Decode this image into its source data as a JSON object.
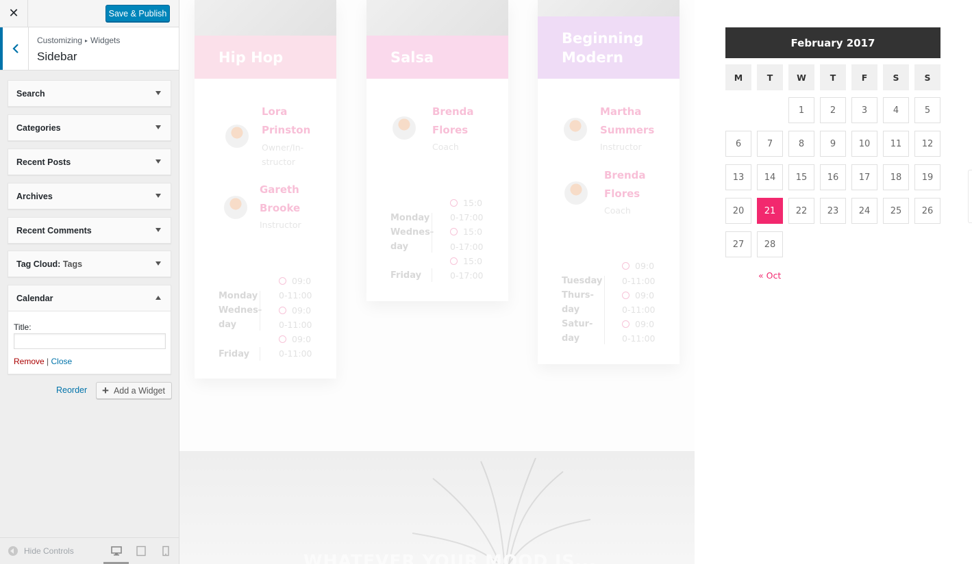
{
  "customizer": {
    "close_symbol": "✕",
    "save_label": "Save & Publish",
    "breadcrumb": {
      "root": "Customizing",
      "separator": "▸",
      "current": "Widgets"
    },
    "section_title": "Sidebar",
    "widgets": [
      {
        "title": "Search",
        "subtitle": ""
      },
      {
        "title": "Categories",
        "subtitle": ""
      },
      {
        "title": "Recent Posts",
        "subtitle": ""
      },
      {
        "title": "Archives",
        "subtitle": ""
      },
      {
        "title": "Recent Comments",
        "subtitle": ""
      },
      {
        "title": "Tag Cloud:",
        "subtitle": "Tags"
      },
      {
        "title": "Calendar",
        "subtitle": ""
      }
    ],
    "calendar_form": {
      "title_label": "Title:",
      "title_value": "",
      "remove_label": "Remove",
      "divider": "|",
      "close_label": "Close"
    },
    "reorder_label": "Reorder",
    "add_widget_label": "Add a Widget",
    "hide_controls_label": "Hide Controls",
    "accent_color": "#0085ba"
  },
  "preview": {
    "classes": [
      {
        "name": "Hip Hop",
        "band_color": "#fbe0ea",
        "instructors": [
          {
            "name_line1": "Lora",
            "name_line2": "Prinston",
            "role_line1": "Owner/In-",
            "role_line2": "structor"
          },
          {
            "name_line1": "Gareth",
            "name_line2": "Brooke",
            "role_line1": "Instructor",
            "role_line2": ""
          }
        ],
        "schedule": {
          "days": [
            "Monday",
            "Wednes-",
            "day",
            "",
            "Friday"
          ],
          "times": [
            "09:0",
            "0-11:00",
            "09:0",
            "0-11:00",
            "09:0",
            "0-11:00"
          ]
        }
      },
      {
        "name": "Salsa",
        "band_color": "#fad9ec",
        "instructors": [
          {
            "name_line1": "Brenda",
            "name_line2": "Flores",
            "role_line1": "Coach",
            "role_line2": ""
          }
        ],
        "schedule": {
          "days": [
            "Monday",
            "Wednes-",
            "day",
            "",
            "Friday"
          ],
          "times": [
            "15:0",
            "0-17:00",
            "15:0",
            "0-17:00",
            "15:0",
            "0-17:00"
          ]
        }
      },
      {
        "name_line1": "Beginning",
        "name_line2": "Modern",
        "band_color": "#efdcf6",
        "instructors": [
          {
            "name_line1": "Martha",
            "name_line2": "Summers",
            "role_line1": "Instructor",
            "role_line2": ""
          },
          {
            "name_line1": "Brenda",
            "name_line2": "Flores",
            "role_line1": "Coach",
            "role_line2": ""
          }
        ],
        "schedule": {
          "days": [
            "Tuesday",
            "Thurs-",
            "day",
            "Satur-",
            "day"
          ],
          "times": [
            "09:0",
            "0-11:00",
            "09:0",
            "0-11:00",
            "09:0",
            "0-11:00"
          ]
        }
      }
    ],
    "hero_caption": "WHATEVER YOUR MOOD IS..."
  },
  "calendar": {
    "caption": "February 2017",
    "weekdays": [
      "M",
      "T",
      "W",
      "T",
      "F",
      "S",
      "S"
    ],
    "first_weekday_index": 2,
    "days_in_month": 28,
    "today": 21,
    "prev_link": "« Oct",
    "accent_color": "#f2286e"
  }
}
